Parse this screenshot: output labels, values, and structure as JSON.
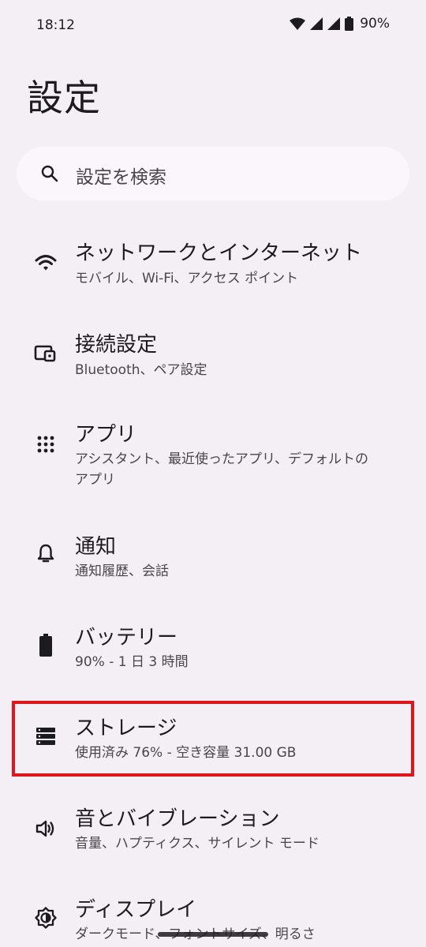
{
  "status_bar": {
    "time": "18:12",
    "battery_percent": "90%"
  },
  "header": {
    "title": "設定"
  },
  "search": {
    "placeholder": "設定を検索"
  },
  "settings": [
    {
      "id": "network",
      "title": "ネットワークとインターネット",
      "subtitle": "モバイル、Wi-Fi、アクセス ポイント",
      "icon": "wifi-icon"
    },
    {
      "id": "connected",
      "title": "接続設定",
      "subtitle": "Bluetooth、ペア設定",
      "icon": "devices-icon"
    },
    {
      "id": "apps",
      "title": "アプリ",
      "subtitle": "アシスタント、最近使ったアプリ、デフォルトの\nアプリ",
      "icon": "apps-grid-icon"
    },
    {
      "id": "notifications",
      "title": "通知",
      "subtitle": "通知履歴、会話",
      "icon": "bell-icon"
    },
    {
      "id": "battery",
      "title": "バッテリー",
      "subtitle": "90% - 1 日 3 時間",
      "icon": "battery-icon"
    },
    {
      "id": "storage",
      "title": "ストレージ",
      "subtitle": "使用済み 76% - 空き容量 31.00 GB",
      "icon": "storage-icon"
    },
    {
      "id": "sound",
      "title": "音とバイブレーション",
      "subtitle": "音量、ハプティクス、サイレント モード",
      "icon": "volume-icon"
    },
    {
      "id": "display",
      "title": "ディスプレイ",
      "subtitle": "ダークモード、フォントサイズ、明るさ",
      "icon": "brightness-icon"
    }
  ],
  "colors": {
    "background": "#f4eff4",
    "search_bg": "#fbf6fc",
    "highlight": "#e0161d",
    "text_primary": "#1c1b1f",
    "text_secondary": "#49454f"
  }
}
